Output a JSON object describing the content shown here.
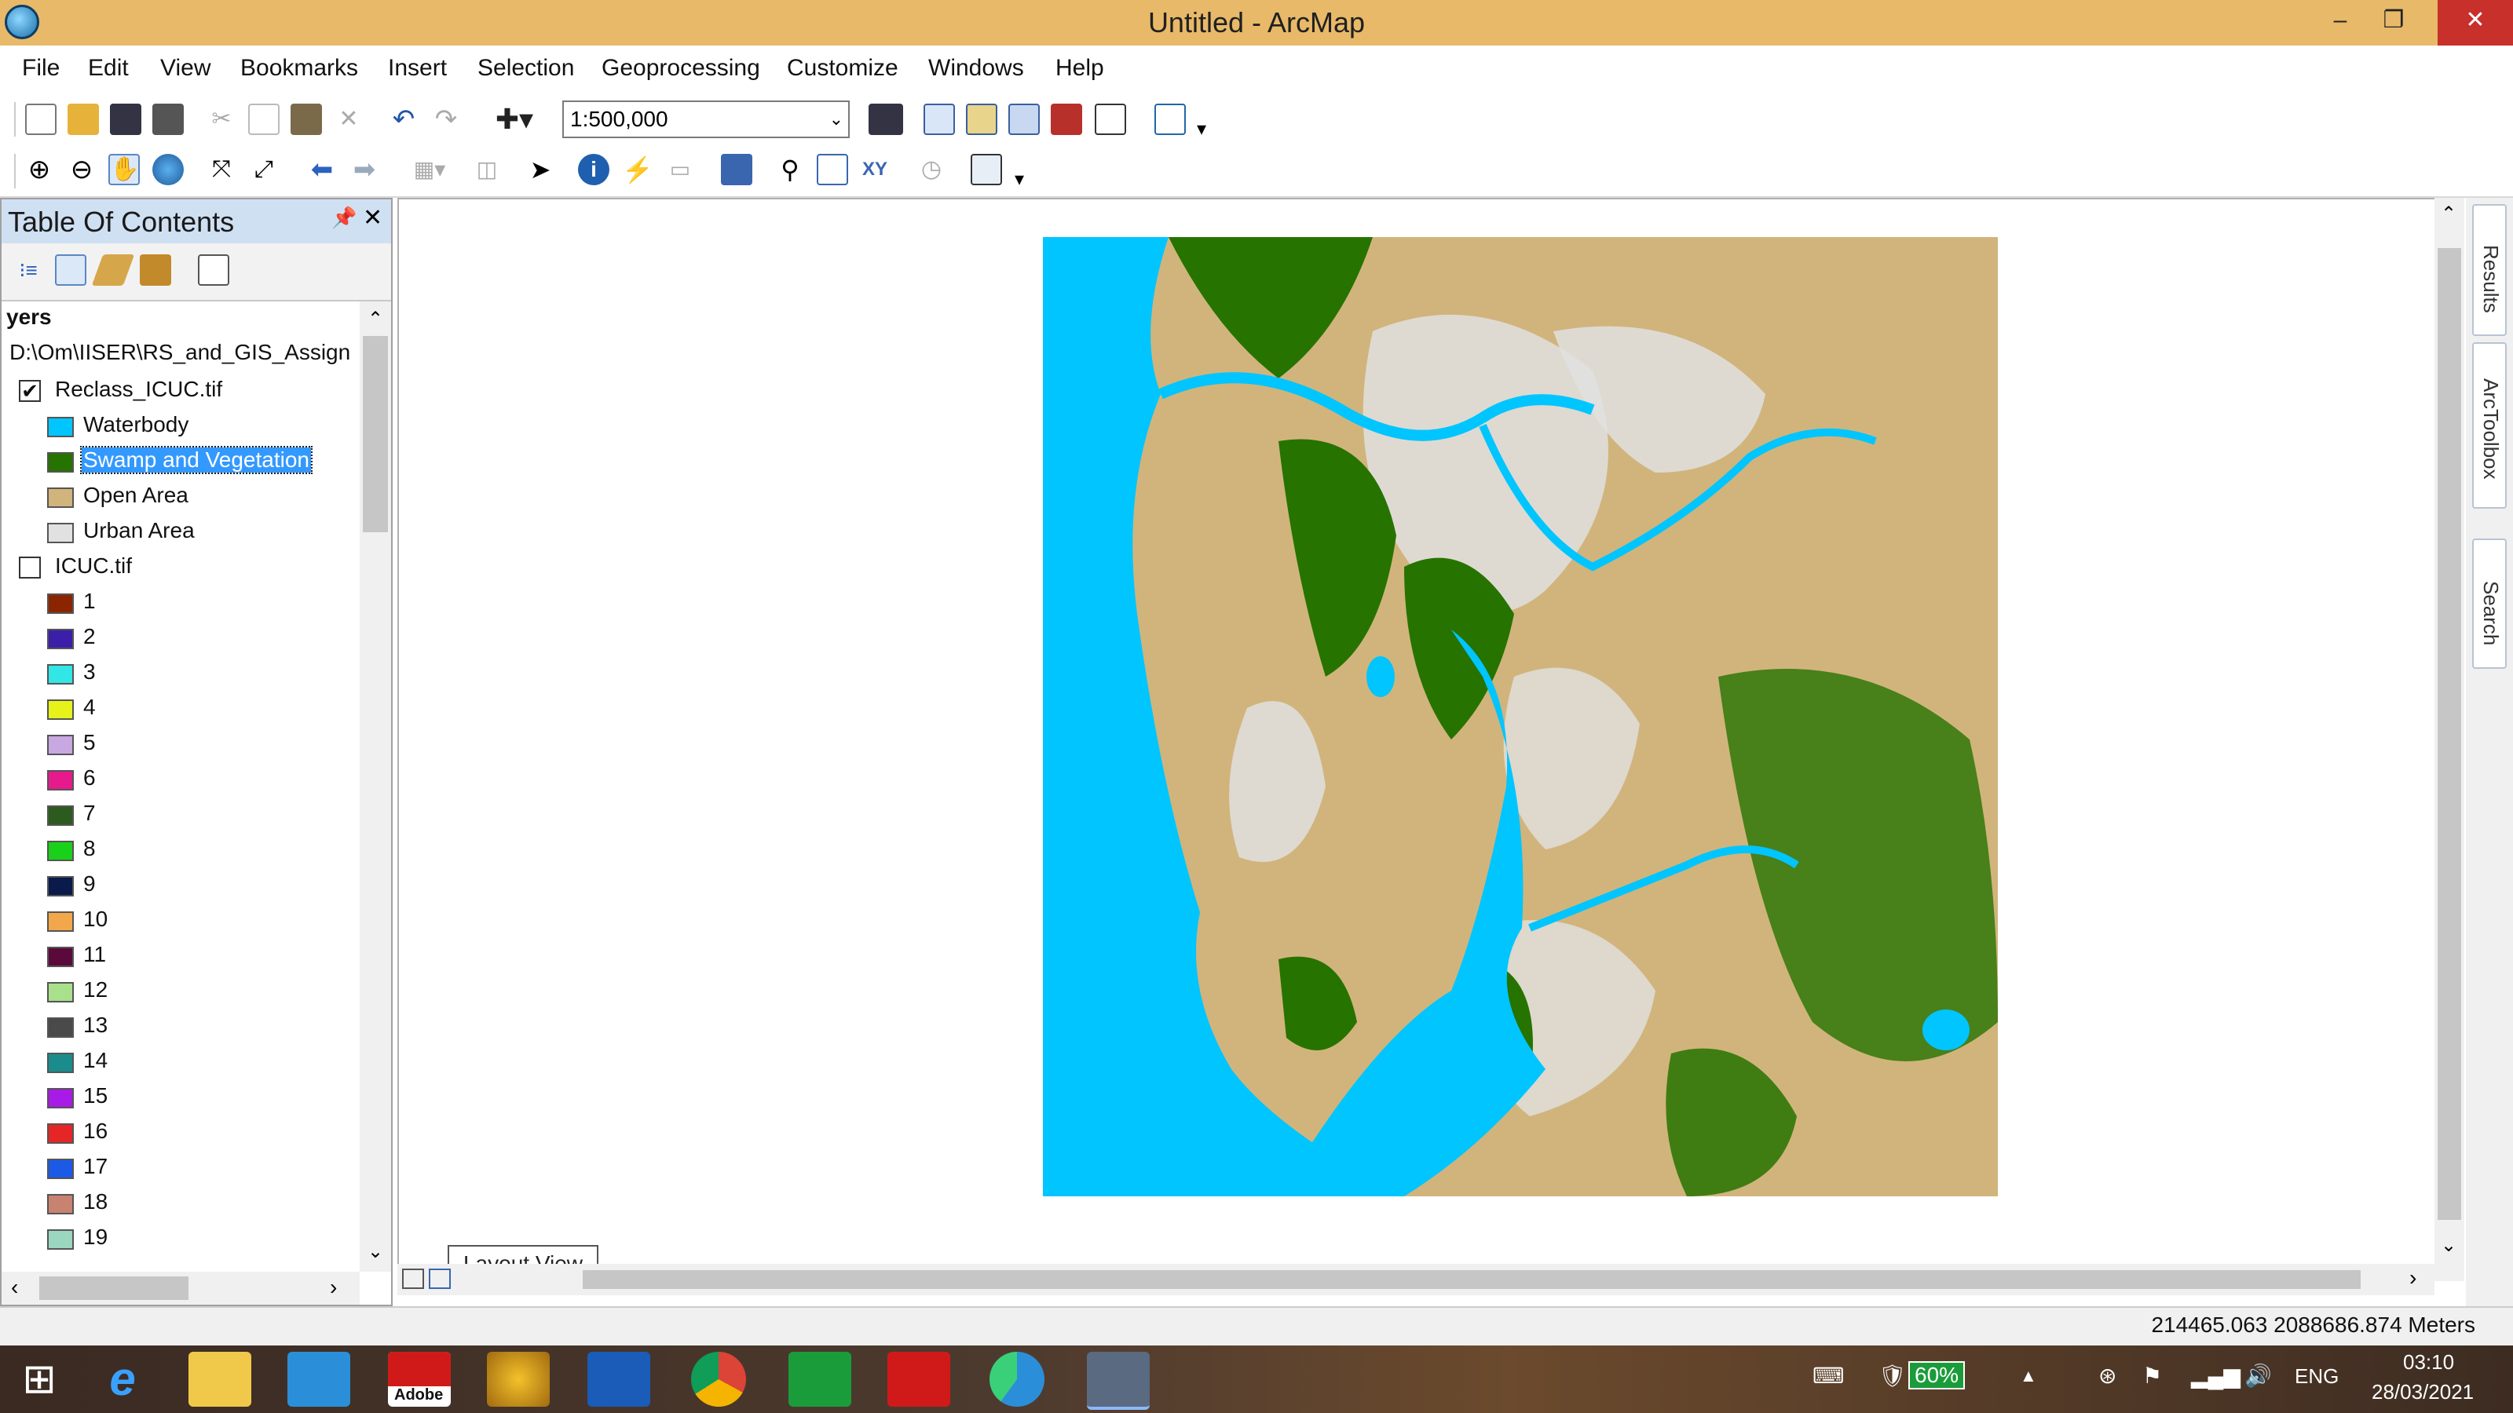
{
  "window": {
    "title": "Untitled - ArcMap",
    "minimize_label": "–",
    "restore_label": "❐",
    "close_label": "✕"
  },
  "menu": [
    "File",
    "Edit",
    "View",
    "Bookmarks",
    "Insert",
    "Selection",
    "Geoprocessing",
    "Customize",
    "Windows",
    "Help"
  ],
  "toolbar": {
    "scale": "1:500,000",
    "standard_icons": [
      "new-icon",
      "open-icon",
      "save-icon",
      "print-icon",
      "cut-icon",
      "copy-icon",
      "paste-icon",
      "delete-icon",
      "undo-icon",
      "redo-icon",
      "add-data-icon"
    ],
    "tools_icons": [
      "zoom-in-icon",
      "zoom-out-icon",
      "pan-icon",
      "full-extent-icon",
      "fixed-zoom-in-icon",
      "fixed-zoom-out-icon",
      "back-icon",
      "forward-icon",
      "select-features-icon",
      "clear-selection-icon",
      "select-elements-icon",
      "identify-icon",
      "hyperlink-icon",
      "html-popup-icon",
      "measure-icon",
      "find-icon",
      "find-route-icon",
      "goto-xy-icon",
      "time-slider-icon",
      "create-viewer-icon"
    ]
  },
  "toc": {
    "title": "Table Of Contents",
    "pin_label": "📌",
    "close_label": "✕",
    "group_label": "yers",
    "path_label": "D:\\Om\\IISER\\RS_and_GIS_Assign",
    "layers": [
      {
        "name": "Reclass_ICUC.tif",
        "checked": true,
        "classes": [
          {
            "label": "Waterbody",
            "color": "#00c5ff"
          },
          {
            "label": "Swamp and Vegetation",
            "color": "#267300",
            "selected": true
          },
          {
            "label": "Open Area",
            "color": "#d1b47c"
          },
          {
            "label": "Urban Area",
            "color": "#e1e1e1"
          }
        ]
      },
      {
        "name": "ICUC.tif",
        "checked": false,
        "classes": [
          {
            "label": "1",
            "color": "#8b2500"
          },
          {
            "label": "2",
            "color": "#3b1fa8"
          },
          {
            "label": "3",
            "color": "#33e6e6"
          },
          {
            "label": "4",
            "color": "#e6f21a"
          },
          {
            "label": "5",
            "color": "#c8a8e0"
          },
          {
            "label": "6",
            "color": "#e61a8c"
          },
          {
            "label": "7",
            "color": "#2d5a1e"
          },
          {
            "label": "8",
            "color": "#1ad11a"
          },
          {
            "label": "9",
            "color": "#0a1a4a"
          },
          {
            "label": "10",
            "color": "#f2a84a"
          },
          {
            "label": "11",
            "color": "#5a0a3a"
          },
          {
            "label": "12",
            "color": "#a8e08c"
          },
          {
            "label": "13",
            "color": "#4a4a4a"
          },
          {
            "label": "14",
            "color": "#1a8c8c"
          },
          {
            "label": "15",
            "color": "#a81ae6"
          },
          {
            "label": "16",
            "color": "#e62626"
          },
          {
            "label": "17",
            "color": "#1a5ae6"
          },
          {
            "label": "18",
            "color": "#c88270"
          },
          {
            "label": "19",
            "color": "#9ad6c0"
          }
        ]
      }
    ]
  },
  "map": {
    "water_color": "#00c5ff",
    "veg_color": "#267300",
    "open_color": "#d1b47c",
    "urban_color": "#e1e1e1"
  },
  "tooltip": "Layout View",
  "dock_tabs": [
    "Results",
    "ArcToolbox",
    "Search"
  ],
  "status": {
    "coordinates": "214465.063  2088686.874 Meters"
  },
  "taskbar": {
    "apps": [
      "windows-start-icon",
      "internet-explorer-icon",
      "file-explorer-icon",
      "mail-icon",
      "adobe-icon",
      "headphones-app-icon",
      "lenovo-icon",
      "chrome-icon",
      "store-icon",
      "3d-viewer-icon",
      "edge-icon",
      "arcmap-icon"
    ],
    "adobe_label": "Adobe",
    "battery": "60%",
    "language": "ENG",
    "time": "03:10",
    "date": "28/03/2021"
  }
}
